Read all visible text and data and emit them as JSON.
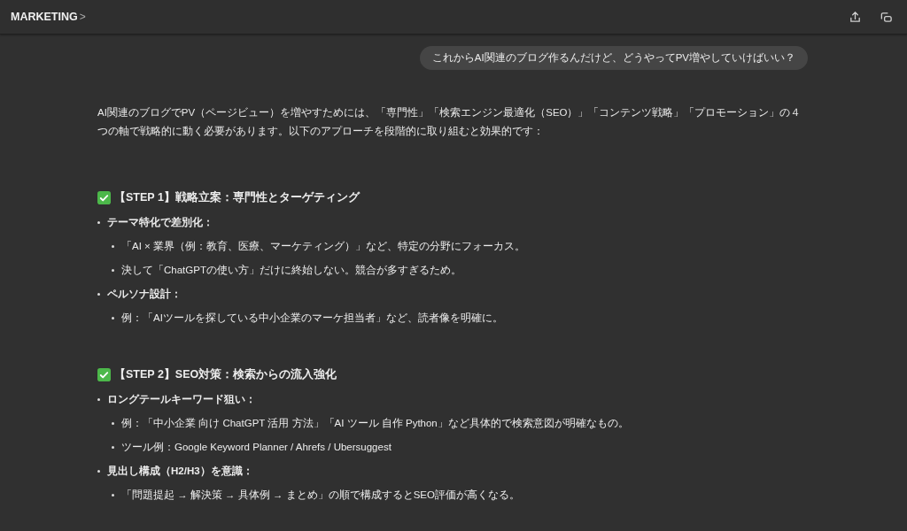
{
  "header": {
    "title": "MARKETING",
    "chevron": ">"
  },
  "user_message": "これからAI関連のブログ作るんだけど、どうやってPV増やしていけばいい？",
  "response": {
    "intro": "AI関連のブログでPV（ページビュー）を増やすためには、「専門性」「検索エンジン最適化（SEO）」「コンテンツ戦略」「プロモーション」の４つの軸で戦略的に動く必要があります。以下のアプローチを段階的に取り組むと効果的です：",
    "sections": [
      {
        "heading": "【STEP 1】戦略立案：専門性とターゲティング",
        "items": [
          {
            "text": "テーマ特化で差別化：",
            "children": [
              {
                "text": "「AI × 業界（例：教育、医療、マーケティング）」など、特定の分野にフォーカス。"
              },
              {
                "text": "決して「ChatGPTの使い方」だけに終始しない。競合が多すぎるため。"
              }
            ]
          },
          {
            "text": "ペルソナ設計：",
            "children": [
              {
                "text": "例：「AIツールを探している中小企業のマーケ担当者」など、読者像を明確に。"
              }
            ]
          }
        ]
      },
      {
        "heading": "【STEP 2】SEO対策：検索からの流入強化",
        "items": [
          {
            "text": "ロングテールキーワード狙い：",
            "children": [
              {
                "text": "例：「中小企業 向け ChatGPT 活用 方法」「AI ツール 自作 Python」など具体的で検索意図が明確なもの。"
              },
              {
                "text": "ツール例：Google Keyword Planner / Ahrefs / Ubersuggest"
              }
            ]
          },
          {
            "text": "見出し構成（H2/H3）を意識：",
            "children": [
              {
                "text": "「問題提起 → 解決策 → 具体例 → まとめ」の順で構成するとSEO評価が高くなる。"
              }
            ]
          }
        ]
      }
    ]
  }
}
